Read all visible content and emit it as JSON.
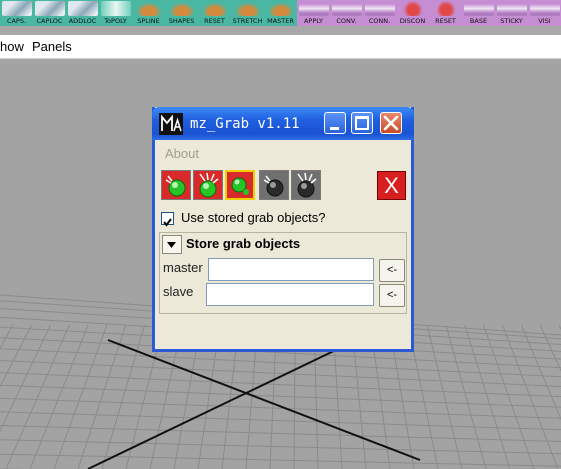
{
  "shelf": {
    "buttons": [
      {
        "label": "CAPS.",
        "icon": "capsule-icon"
      },
      {
        "label": "CAPLOC",
        "icon": "capsule-locator-icon"
      },
      {
        "label": "ADDLOC",
        "icon": "add-locator-icon"
      },
      {
        "label": "ToPOLY",
        "icon": "to-poly-icon"
      },
      {
        "label": "SPLINE",
        "icon": "spline-icon"
      },
      {
        "label": "SHAPES",
        "icon": "shapes-icon"
      },
      {
        "label": "RESET",
        "icon": "reset-icon"
      },
      {
        "label": "STRETCH",
        "icon": "stretch-icon"
      },
      {
        "label": "MASTER",
        "icon": "master-icon"
      },
      {
        "label": "APPLY",
        "icon": "apply-icon"
      },
      {
        "label": "CONV.",
        "icon": "convert-icon"
      },
      {
        "label": "CONN.",
        "icon": "connect-icon"
      },
      {
        "label": "DISCON",
        "icon": "disconnect-icon"
      },
      {
        "label": "RESET",
        "icon": "reset-icon"
      },
      {
        "label": "BASE",
        "icon": "base-icon"
      },
      {
        "label": "STICKY",
        "icon": "sticky-icon"
      },
      {
        "label": "VISI",
        "icon": "visibility-icon"
      }
    ],
    "group_colors": [
      "#49b7a2",
      "#c58ed2"
    ]
  },
  "menubar": {
    "items": [
      "how",
      "Panels"
    ]
  },
  "window": {
    "title": "mz_Grab v1.11",
    "menu_about": "About",
    "tool_icons": [
      "grab-icon",
      "grab-spring-icon",
      "grab-select-icon",
      "release-icon",
      "release-spring-icon",
      "close-tool-icon"
    ],
    "close_tool_label": "X",
    "checkbox": {
      "label": "Use stored grab objects?",
      "checked": true
    },
    "frame": {
      "title": "Store grab objects",
      "master_label": "master",
      "master_value": "",
      "slave_label": "slave",
      "slave_value": "",
      "pick_label": "<-"
    },
    "title_color": "#1f5fe0",
    "tool_red": "#d82a2a",
    "tool_green": "#27c227"
  }
}
